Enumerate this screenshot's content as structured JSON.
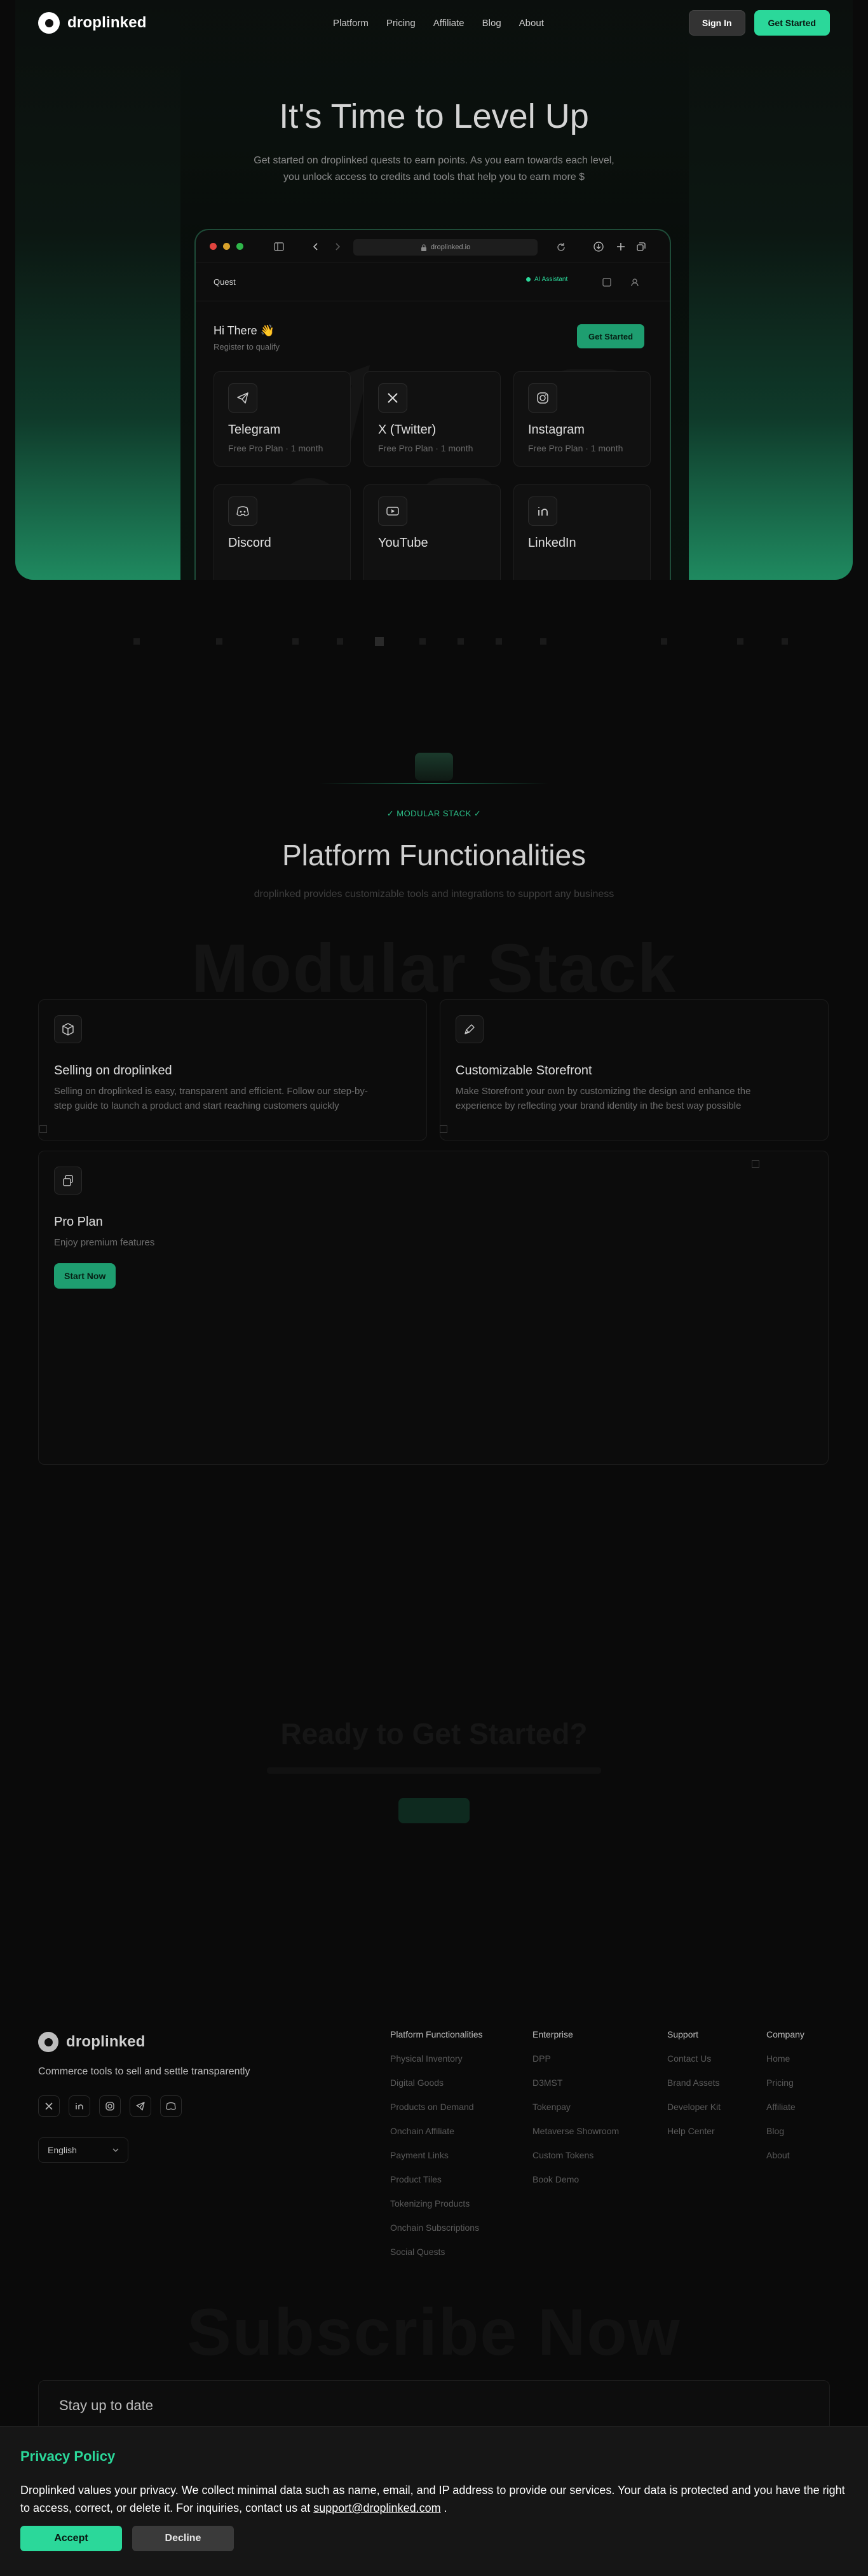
{
  "nav": {
    "brand": "droplinked",
    "links": [
      "Platform",
      "Pricing",
      "Affiliate",
      "Blog",
      "About"
    ],
    "sign_in": "Sign In",
    "get_started": "Get Started"
  },
  "hero": {
    "title": "It's Time to Level Up",
    "subtitle_line1": "Get started on droplinked quests to earn points. As you earn towards each level,",
    "subtitle_line2": "you unlock access to credits and tools that help you to earn more $"
  },
  "browser": {
    "url": "droplinked.io",
    "quest_label": "Quest",
    "badge": "AI Assistant",
    "greeting": "Hi There 👋",
    "register": "Register to qualify",
    "cta": "Get Started",
    "cards": [
      {
        "title": "Telegram",
        "plan": "Free Pro Plan",
        "duration": "1 month",
        "icon": "telegram-icon"
      },
      {
        "title": "X (Twitter)",
        "plan": "Free Pro Plan",
        "duration": "1 month",
        "icon": "x-icon"
      },
      {
        "title": "Instagram",
        "plan": "Free Pro Plan",
        "duration": "1 month",
        "icon": "instagram-icon"
      },
      {
        "title": "Discord",
        "icon": "discord-icon"
      },
      {
        "title": "YouTube",
        "icon": "youtube-icon"
      },
      {
        "title": "LinkedIn",
        "icon": "linkedin-icon"
      }
    ]
  },
  "modular": {
    "label": "✓ MODULAR STACK ✓",
    "title": "Platform Functionalities",
    "subtitle": "droplinked provides customizable tools and integrations to support any business",
    "ghost": "Modular Stack"
  },
  "features": [
    {
      "title": "Selling on droplinked",
      "desc_line1": "Selling on droplinked is easy, transparent and efficient. Follow our step-by-",
      "desc_line2": "step guide to launch a product and start reaching customers quickly",
      "icon": "box-icon"
    },
    {
      "title": "Customizable Storefront",
      "desc_line1": "Make Storefront your own by customizing the design and enhance the",
      "desc_line2": "experience by reflecting your brand identity in the best way possible",
      "icon": "pen-icon"
    },
    {
      "title": "Pro Plan",
      "desc_line1": "Enjoy premium features",
      "cta": "Start Now",
      "icon": "layers-icon"
    }
  ],
  "cta_section": {
    "title": "Ready to Get Started?"
  },
  "footer": {
    "brand": "droplinked",
    "tagline": "Commerce tools to sell and settle transparently",
    "language": "English",
    "columns": [
      {
        "heading": "Platform Functionalities",
        "links": [
          "Physical Inventory",
          "Digital Goods",
          "Products on Demand",
          "Onchain Affiliate",
          "Payment Links",
          "Product Tiles",
          "Tokenizing Products",
          "Onchain Subscriptions",
          "Social Quests"
        ]
      },
      {
        "heading": "Enterprise",
        "links": [
          "DPP",
          "D3MST",
          "Tokenpay",
          "Metaverse Showroom",
          "Custom Tokens",
          "Book Demo"
        ]
      },
      {
        "heading": "Support",
        "links": [
          "Contact Us",
          "Brand Assets",
          "Developer Kit",
          "Help Center"
        ]
      },
      {
        "heading": "Company",
        "links": [
          "Home",
          "Pricing",
          "Affiliate",
          "Blog",
          "About"
        ]
      }
    ]
  },
  "subscribe": {
    "ghost": "Subscribe Now",
    "title": "Stay up to date"
  },
  "privacy": {
    "title": "Privacy Policy",
    "text": "Droplinked values your privacy. We collect minimal data such as name, email, and IP address to provide our services. Your data is protected and you have the right to access, correct, or delete it. For inquiries, contact us at",
    "email": "support@droplinked.com",
    "period": ".",
    "accept": "Accept",
    "decline": "Decline"
  },
  "colors": {
    "accent": "#2bd89a",
    "background": "#0a0a0a",
    "hero_glow": "#1f8a60"
  }
}
